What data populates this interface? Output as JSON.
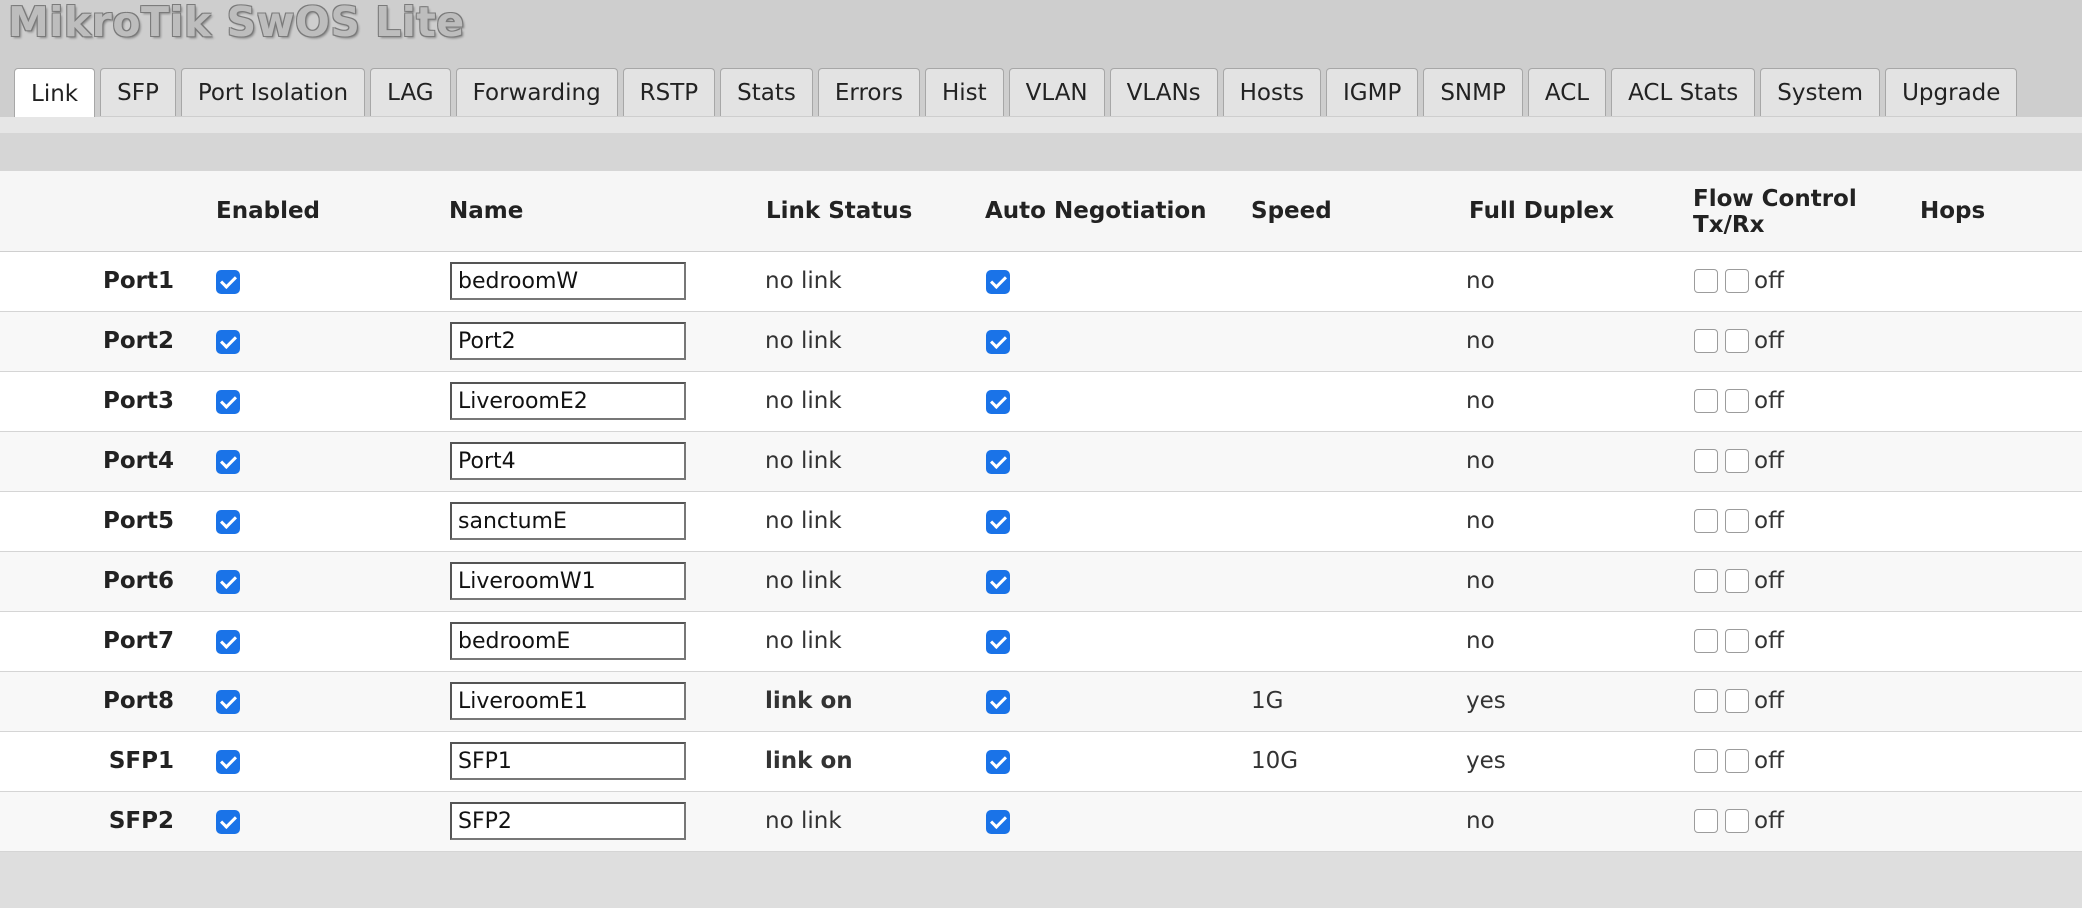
{
  "app": {
    "title": "MikroTik SwOS Lite"
  },
  "tabs": [
    {
      "label": "Link",
      "active": true
    },
    {
      "label": "SFP"
    },
    {
      "label": "Port Isolation"
    },
    {
      "label": "LAG"
    },
    {
      "label": "Forwarding"
    },
    {
      "label": "RSTP"
    },
    {
      "label": "Stats"
    },
    {
      "label": "Errors"
    },
    {
      "label": "Hist"
    },
    {
      "label": "VLAN"
    },
    {
      "label": "VLANs"
    },
    {
      "label": "Hosts"
    },
    {
      "label": "IGMP"
    },
    {
      "label": "SNMP"
    },
    {
      "label": "ACL"
    },
    {
      "label": "ACL Stats"
    },
    {
      "label": "System"
    },
    {
      "label": "Upgrade"
    }
  ],
  "table": {
    "headers": {
      "enabled": "Enabled",
      "name": "Name",
      "link_status": "Link Status",
      "auto_negotiation": "Auto Negotiation",
      "speed": "Speed",
      "full_duplex": "Full Duplex",
      "flow_control_line1": "Flow Control",
      "flow_control_line2": "Tx/Rx",
      "hops": "Hops"
    },
    "rows": [
      {
        "port": "Port1",
        "enabled": true,
        "name": "bedroomW",
        "link_status": "no link",
        "link_on": false,
        "auto_negotiation": true,
        "speed": "",
        "full_duplex": "no",
        "flow_tx": false,
        "flow_rx": false,
        "flow_text": "off"
      },
      {
        "port": "Port2",
        "enabled": true,
        "name": "Port2",
        "link_status": "no link",
        "link_on": false,
        "auto_negotiation": true,
        "speed": "",
        "full_duplex": "no",
        "flow_tx": false,
        "flow_rx": false,
        "flow_text": "off"
      },
      {
        "port": "Port3",
        "enabled": true,
        "name": "LiveroomE2",
        "link_status": "no link",
        "link_on": false,
        "auto_negotiation": true,
        "speed": "",
        "full_duplex": "no",
        "flow_tx": false,
        "flow_rx": false,
        "flow_text": "off"
      },
      {
        "port": "Port4",
        "enabled": true,
        "name": "Port4",
        "link_status": "no link",
        "link_on": false,
        "auto_negotiation": true,
        "speed": "",
        "full_duplex": "no",
        "flow_tx": false,
        "flow_rx": false,
        "flow_text": "off"
      },
      {
        "port": "Port5",
        "enabled": true,
        "name": "sanctumE",
        "link_status": "no link",
        "link_on": false,
        "auto_negotiation": true,
        "speed": "",
        "full_duplex": "no",
        "flow_tx": false,
        "flow_rx": false,
        "flow_text": "off"
      },
      {
        "port": "Port6",
        "enabled": true,
        "name": "LiveroomW1",
        "link_status": "no link",
        "link_on": false,
        "auto_negotiation": true,
        "speed": "",
        "full_duplex": "no",
        "flow_tx": false,
        "flow_rx": false,
        "flow_text": "off"
      },
      {
        "port": "Port7",
        "enabled": true,
        "name": "bedroomE",
        "link_status": "no link",
        "link_on": false,
        "auto_negotiation": true,
        "speed": "",
        "full_duplex": "no",
        "flow_tx": false,
        "flow_rx": false,
        "flow_text": "off"
      },
      {
        "port": "Port8",
        "enabled": true,
        "name": "LiveroomE1",
        "link_status": "link on",
        "link_on": true,
        "auto_negotiation": true,
        "speed": "1G",
        "full_duplex": "yes",
        "flow_tx": false,
        "flow_rx": false,
        "flow_text": "off"
      },
      {
        "port": "SFP1",
        "enabled": true,
        "name": "SFP1",
        "link_status": "link on",
        "link_on": true,
        "auto_negotiation": true,
        "speed": "10G",
        "full_duplex": "yes",
        "flow_tx": false,
        "flow_rx": false,
        "flow_text": "off"
      },
      {
        "port": "SFP2",
        "enabled": true,
        "name": "SFP2",
        "link_status": "no link",
        "link_on": false,
        "auto_negotiation": true,
        "speed": "",
        "full_duplex": "no",
        "flow_tx": false,
        "flow_rx": false,
        "flow_text": "off"
      }
    ]
  }
}
